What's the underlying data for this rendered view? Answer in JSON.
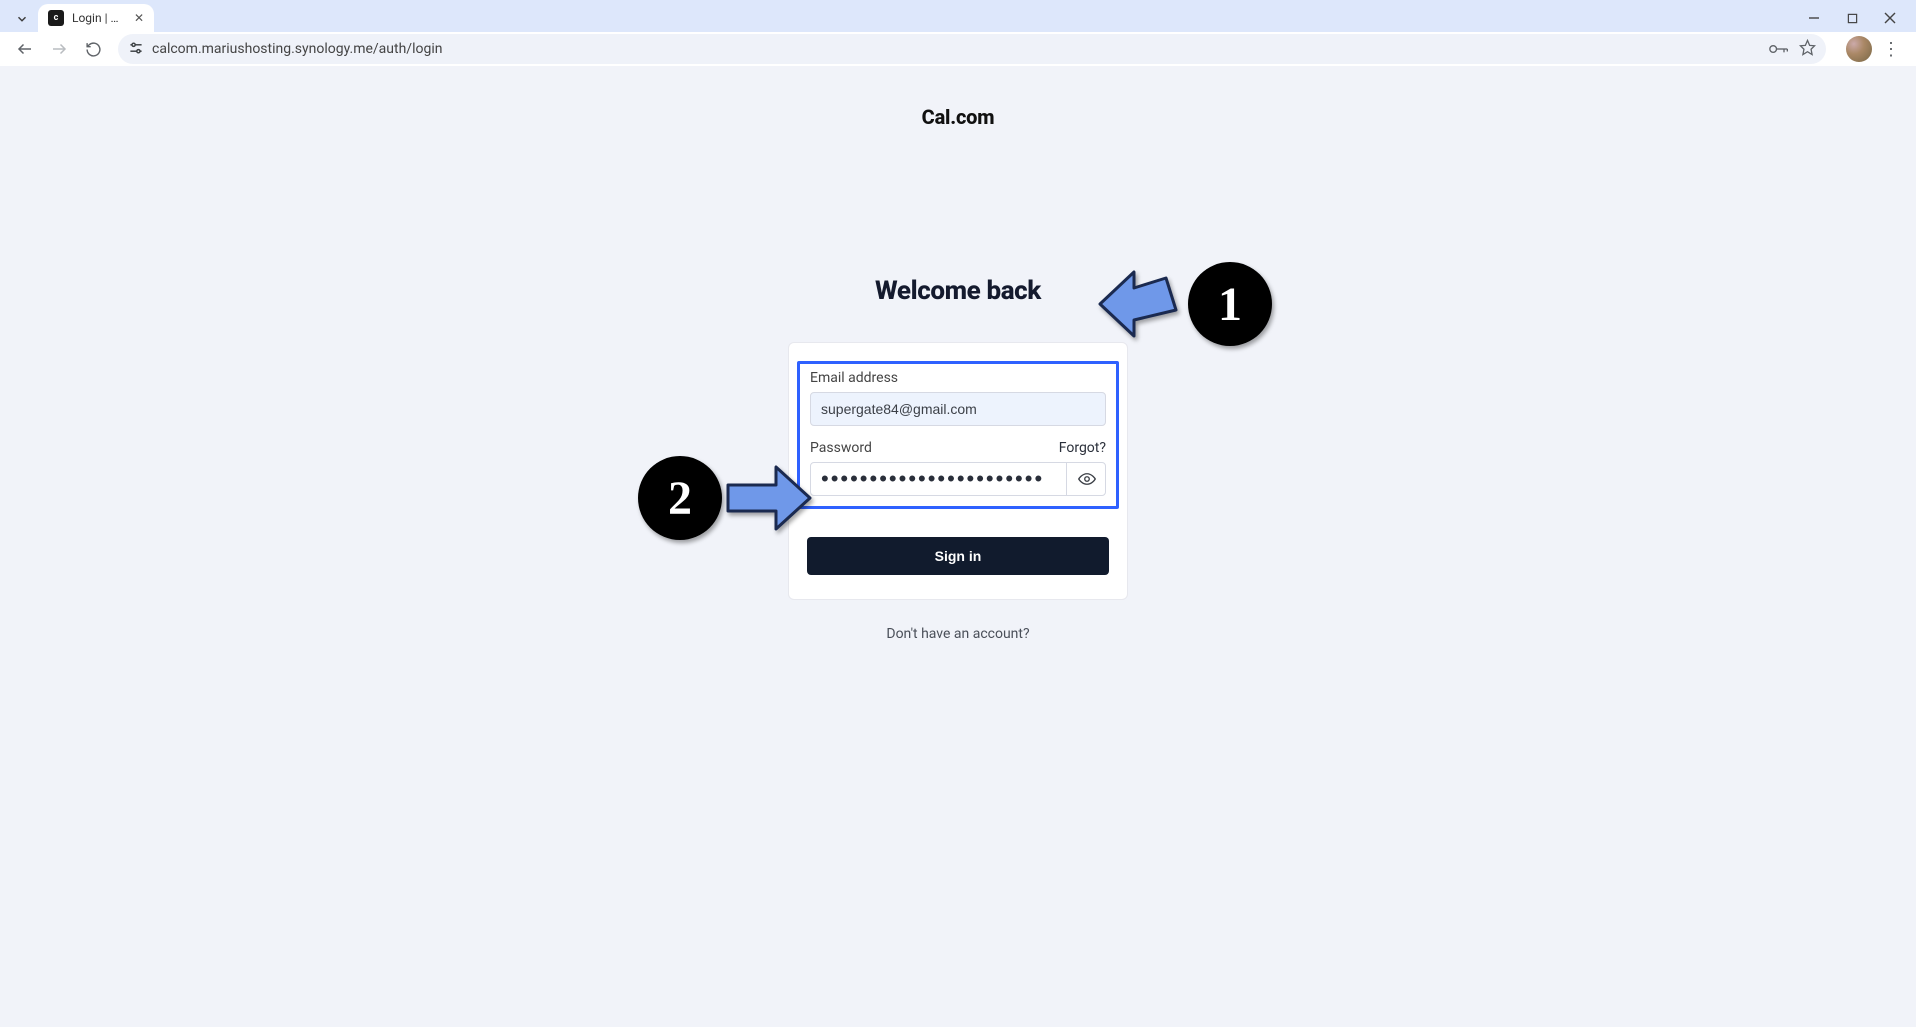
{
  "browser": {
    "tab_title": "Login | Cal",
    "url": "calcom.mariushosting.synology.me/auth/login"
  },
  "brand": "Cal.com",
  "heading": "Welcome back",
  "form": {
    "email_label": "Email address",
    "email_value": "supergate84@gmail.com",
    "password_label": "Password",
    "forgot_label": "Forgot?",
    "password_mask": "•••••••••••••••••••••••",
    "signin_label": "Sign in"
  },
  "footer": {
    "no_account": "Don't have an account?"
  },
  "annotations": {
    "step1": "1",
    "step2": "2"
  }
}
